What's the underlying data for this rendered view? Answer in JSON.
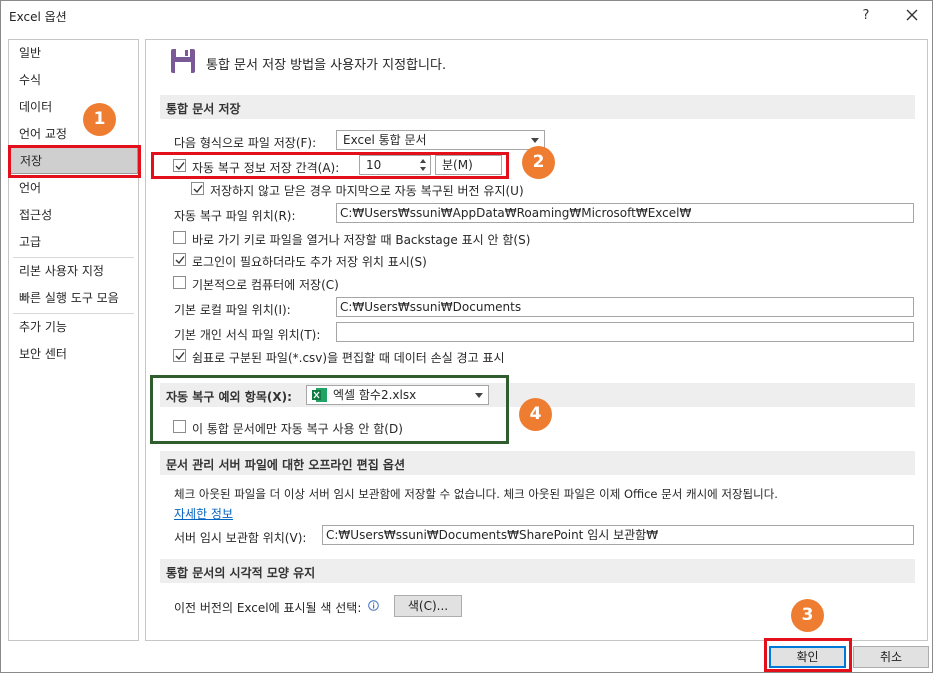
{
  "window": {
    "title": "Excel 옵션",
    "help_label": "?"
  },
  "sidebar": {
    "items": [
      {
        "label": "일반"
      },
      {
        "label": "수식"
      },
      {
        "label": "데이터"
      },
      {
        "label": "언어 교정"
      },
      {
        "label": "저장",
        "selected": true
      },
      {
        "label": "언어"
      },
      {
        "label": "접근성"
      },
      {
        "label": "고급"
      },
      {
        "label": "리본 사용자 지정"
      },
      {
        "label": "빠른 실행 도구 모음"
      },
      {
        "label": "추가 기능"
      },
      {
        "label": "보안 센터"
      }
    ]
  },
  "header": {
    "text": "통합 문서 저장 방법을 사용자가 지정합니다."
  },
  "save_section": {
    "title": "통합 문서 저장",
    "format_label": "다음 형식으로 파일 저장(F):",
    "format_value": "Excel 통합 문서",
    "autorecover_label": "자동 복구 정보 저장 간격(A):",
    "autorecover_checked": true,
    "autorecover_minutes": "10",
    "minutes_label": "분(M)",
    "keep_last_label": "저장하지 않고 닫은 경우 마지막으로 자동 복구된 버전 유지(U)",
    "keep_last_checked": true,
    "autorecover_location_label": "자동 복구 파일 위치(R):",
    "autorecover_location_value": "C:₩Users₩ssuni₩AppData₩Roaming₩Microsoft₩Excel₩",
    "no_backstage_label": "바로 가기 키로 파일을 열거나 저장할 때 Backstage 표시 안 함(S)",
    "no_backstage_checked": false,
    "show_extra_label": "로그인이 필요하더라도 추가 저장 위치 표시(S)",
    "show_extra_checked": true,
    "save_to_computer_label": "기본적으로 컴퓨터에 저장(C)",
    "save_to_computer_checked": false,
    "local_location_label": "기본 로컬 파일 위치(I):",
    "local_location_value": "C:₩Users₩ssuni₩Documents",
    "template_location_label": "기본 개인 서식 파일 위치(T):",
    "template_location_value": "",
    "csv_warning_label": "쉼표로 구분된 파일(*.csv)을 편집할 때 데이터 손실 경고 표시",
    "csv_warning_checked": true
  },
  "exceptions_section": {
    "title": "자동 복구 예외 항목(X):",
    "workbook_value": "엑셀 함수2.xlsx",
    "disable_label": "이 통합 문서에만 자동 복구 사용 안 함(D)",
    "disable_checked": false
  },
  "offline_section": {
    "title": "문서 관리 서버 파일에 대한 오프라인 편집 옵션",
    "description": "체크 아웃된 파일을 더 이상 서버 임시 보관함에 저장할 수 없습니다. 체크 아웃된 파일은 이제 Office 문서 캐시에 저장됩니다.",
    "learn_more": "자세한 정보",
    "drafts_label": "서버 임시 보관함 위치(V):",
    "drafts_value": "C:₩Users₩ssuni₩Documents₩SharePoint 임시 보관함₩"
  },
  "visual_section": {
    "title": "통합 문서의 시각적 모양 유지",
    "colors_label": "이전 버전의 Excel에 표시될 색 선택:",
    "colors_button": "색(C)..."
  },
  "footer": {
    "ok_label": "확인",
    "cancel_label": "취소"
  },
  "annotations": {
    "badge_1": "1",
    "badge_2": "2",
    "badge_3": "3",
    "badge_4": "4",
    "red_color": "#e3101b",
    "green_color": "#2f5d2e",
    "badge_color": "#ef7d31"
  }
}
